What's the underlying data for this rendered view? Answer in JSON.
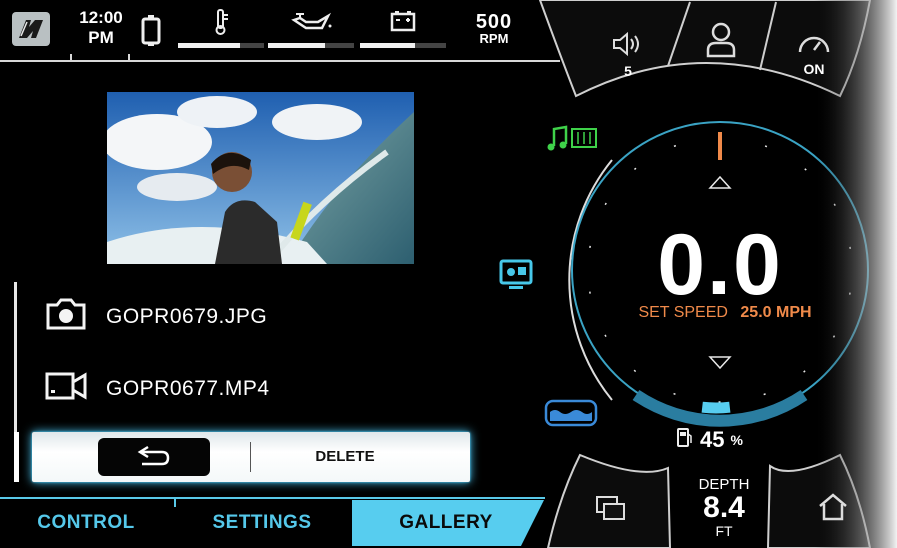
{
  "status_bar": {
    "time": "12:00",
    "meridiem": "PM",
    "gauges": [
      {
        "icon": "thermometer-icon",
        "level": 0.72
      },
      {
        "icon": "oil-can-icon",
        "level": 0.66
      },
      {
        "icon": "battery-icon",
        "level": 0.64
      }
    ],
    "rpm_value": "500",
    "rpm_unit": "RPM"
  },
  "gallery": {
    "files": [
      {
        "icon": "camera-icon",
        "name": "GOPR0679.JPG"
      },
      {
        "icon": "video-camera-icon",
        "name": "GOPR0677.MP4"
      }
    ],
    "delete_label": "DELETE"
  },
  "tabs": [
    {
      "label": "CONTROL",
      "active": false
    },
    {
      "label": "SETTINGS",
      "active": false
    },
    {
      "label": "GALLERY",
      "active": true
    }
  ],
  "quick_buttons": {
    "volume_value": "5",
    "cruise_value": "ON"
  },
  "speedometer": {
    "speed": "0.0",
    "set_speed_label": "SET SPEED",
    "set_speed_value": "25.0 MPH",
    "speed_arc_fraction": 0.2
  },
  "fuel": {
    "value": "45",
    "unit": "%"
  },
  "depth": {
    "label": "DEPTH",
    "value": "8.4",
    "unit": "FT"
  },
  "colors": {
    "accent": "#57cdef",
    "set_speed": "#f08a4a",
    "music": "#3fd24a"
  }
}
